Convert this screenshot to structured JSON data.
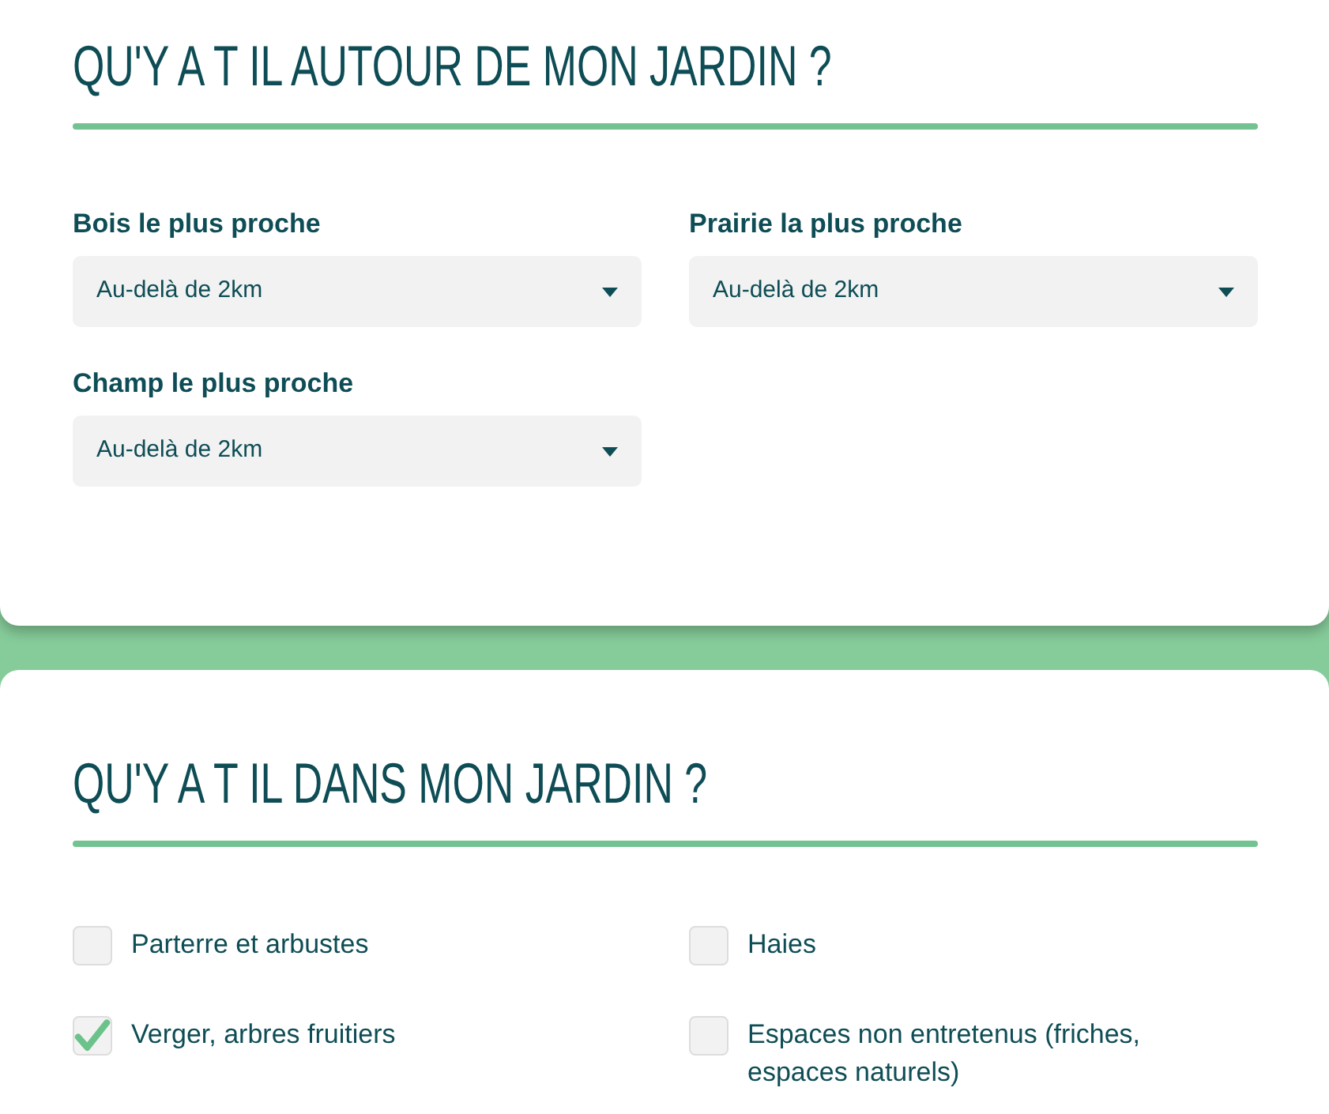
{
  "sections": [
    {
      "title": "QU'Y A T IL AUTOUR DE MON JARDIN ?",
      "selects": [
        {
          "label": "Bois le plus proche",
          "value": "Au-delà de 2km"
        },
        {
          "label": "Prairie la plus proche",
          "value": "Au-delà de 2km"
        },
        {
          "label": "Champ le plus proche",
          "value": "Au-delà de 2km"
        }
      ]
    },
    {
      "title": "QU'Y A T IL DANS MON JARDIN ?",
      "checkboxes": [
        {
          "label": "Parterre et arbustes",
          "checked": false
        },
        {
          "label": "Haies",
          "checked": false
        },
        {
          "label": "Verger, arbres fruitiers",
          "checked": true
        },
        {
          "label": "Espaces non entretenus (friches, espaces naturels)",
          "checked": false
        }
      ]
    }
  ]
}
